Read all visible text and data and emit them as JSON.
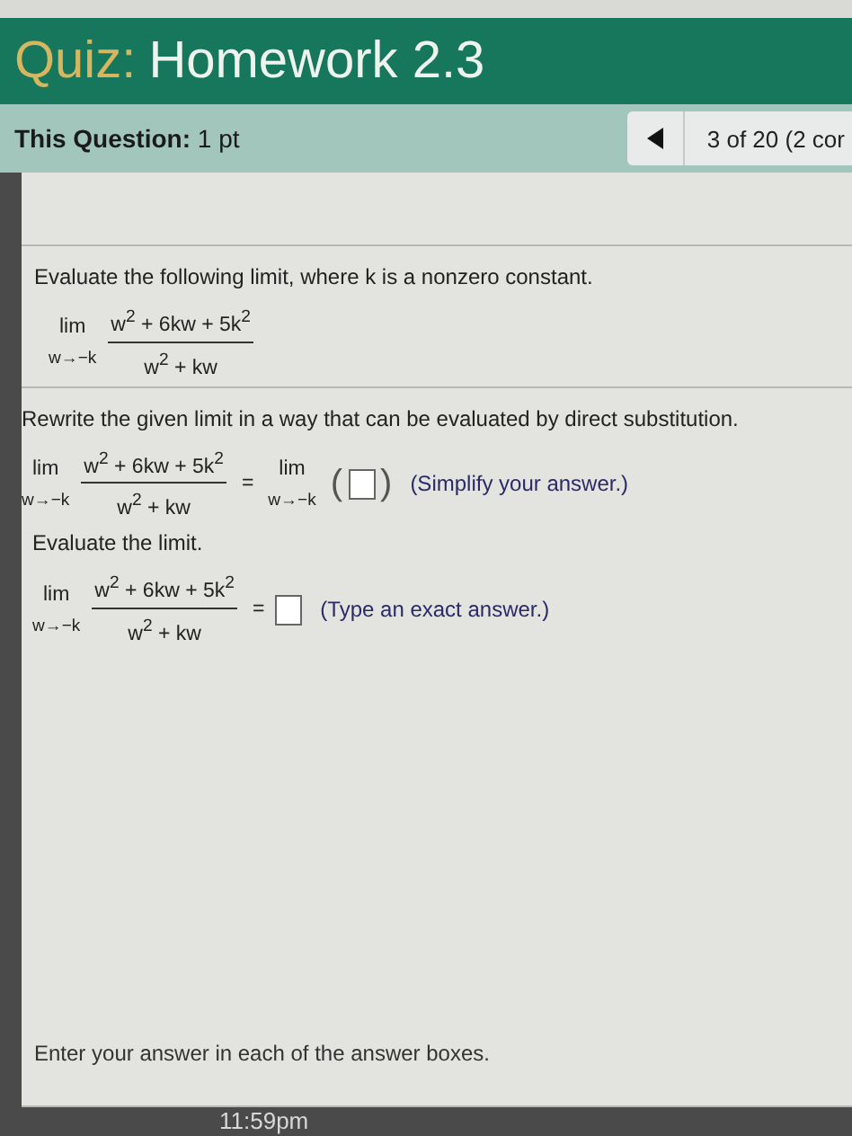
{
  "header": {
    "prefix": "Quiz:",
    "title": "Homework 2.3"
  },
  "question_bar": {
    "label": "This Question:",
    "value": "1 pt",
    "progress": "3 of 20 (2 cor"
  },
  "problem": {
    "text": "Evaluate the following limit, where k is a nonzero constant.",
    "expression": {
      "lim": "lim",
      "sub": "w→−k",
      "numerator": "w$^{2}$ + 6kw + 5k$^{2}$",
      "denominator": "w$^{2}$ + kw"
    }
  },
  "steps": [
    {
      "kind": "paren_box",
      "instruction": "Rewrite the given limit in a way that can be evaluated by direct substitution.",
      "expression": {
        "lim": "lim",
        "sub": "w→−k",
        "numerator": "w$^{2}$ + 6kw + 5k$^{2}$",
        "denominator": "w$^{2}$ + kw"
      },
      "equals": "=",
      "rhs_lim": "lim",
      "rhs_sub": "w→−k",
      "open": "(",
      "close": ")",
      "hint": "(Simplify your answer.)"
    },
    {
      "kind": "box",
      "instruction": "Evaluate the limit.",
      "expression": {
        "lim": "lim",
        "sub": "w→−k",
        "numerator": "w$^{2}$ + 6kw + 5k$^{2}$",
        "denominator": "w$^{2}$ + kw"
      },
      "equals": "=",
      "hint": "(Type an exact answer.)"
    }
  ],
  "footer": "Enter your answer in each of the answer boxes.",
  "clock": "11:59pm"
}
